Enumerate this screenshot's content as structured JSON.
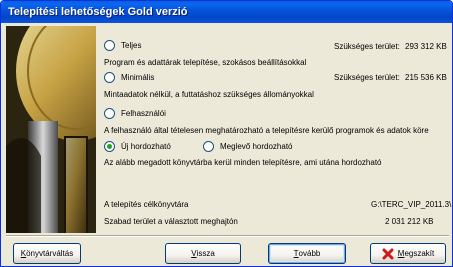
{
  "window": {
    "title": "Telepítési lehetőségek  Gold verzió"
  },
  "options": {
    "full": {
      "label": "Teljes",
      "required_label": "Szükséges terület:",
      "required_value": "293 312 KB",
      "description": "Program és adattárak telepítése, szokásos beállításokkal",
      "selected": false
    },
    "minimal": {
      "label": "Minimális",
      "required_label": "Szükséges terület:",
      "required_value": "215 536 KB",
      "description": "Mintaadatok nélkül, a futtatáshoz szükséges állományokkal",
      "selected": false
    },
    "custom": {
      "label": "Felhasználói",
      "description": "A felhasználó által tételesen meghatározható a telepítésre kerülő programok és  adatok köre",
      "selected": false
    }
  },
  "install_mode": {
    "new": {
      "label": "Új hordozható",
      "selected": true
    },
    "existing": {
      "label": "Meglevő hordozható",
      "selected": false
    },
    "description": "Az alább megadott könyvtárba kerül minden telepítésre, ami utána hordozható"
  },
  "target": {
    "dir_label": "A telepítés célkönyvtára",
    "dir_value": "G:\\TERC_VIP_2011.3\\",
    "free_label": "Szabad terület a választott meghajtón",
    "free_value": "2 031 212 KB"
  },
  "buttons": {
    "change_dir": {
      "prefix": "K",
      "rest": "önyvtárváltás"
    },
    "back": {
      "prefix": "V",
      "rest": "issza"
    },
    "next": {
      "prefix": "T",
      "rest": "ovább"
    },
    "cancel": {
      "prefix": "M",
      "rest": "egszakít"
    }
  },
  "colors": {
    "title_bar": "#0552d8",
    "window_bg": "#ece9d8",
    "radio_dot": "#21a121",
    "cancel_icon": "#d01818"
  },
  "icons": {
    "cancel": "red-x-icon",
    "banner": "coin-banner-image"
  }
}
